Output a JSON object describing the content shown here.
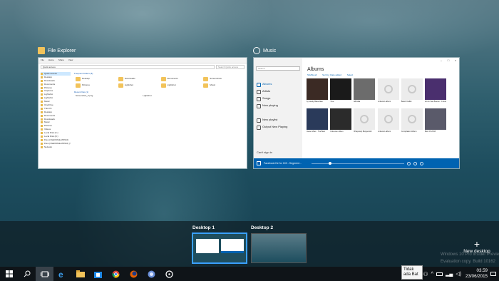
{
  "file_explorer": {
    "title": "File Explorer",
    "ribbon": [
      "File",
      "Home",
      "Share",
      "View"
    ],
    "address": "Quick access",
    "search_placeholder": "Search Quick access",
    "nav": [
      "Quick access",
      "Desktop",
      "Downloads",
      "Documents",
      "Pictures",
      "Captures",
      "Lightshot",
      "Lightshot",
      "Music",
      "OneDrive",
      "This PC",
      "Desktop",
      "Documents",
      "Downloads",
      "Music",
      "Pictures",
      "Videos",
      "Local Disk (C:)",
      "Local Disk (D:)",
      "Files (\\\\GEORGE-WIN10)",
      "Files (\\\\GEORGE-WIN10) (Y:)",
      "Network"
    ],
    "frequent_header": "Frequent folders (8)",
    "folders": [
      "Desktop",
      "Downloads",
      "Documents",
      "Screenshots",
      "Pictures",
      "Lightshot",
      "Lightshot",
      "Music"
    ],
    "recent_header": "Recent files (1)",
    "recent_file": "Screenshot_3.png",
    "recent_path": "Lightshot"
  },
  "music": {
    "title": "Music",
    "app_name": "Music",
    "search_placeholder": "Search",
    "nav": [
      "Albums",
      "Artists",
      "Songs",
      "Now playing",
      "New playlist",
      "Output New Playing"
    ],
    "sign_in": "Can't sign in",
    "heading": "Albums",
    "options": [
      "Shuffle all",
      "Sort by: Date added",
      "Select"
    ],
    "albums": [
      {
        "title": "by Vanity Babe Alan",
        "color": "#3b2a24"
      },
      {
        "title": "True",
        "color": "#1a1a1a"
      },
      {
        "title": "Ellinikia",
        "color": "#6c6c6c"
      },
      {
        "title": "Unknown album",
        "color": "#ececec"
      },
      {
        "title": "Board Catfat",
        "color": "#ececec"
      },
      {
        "title": "Armin Van Buuren - Future",
        "color": "#4a2f6e"
      },
      {
        "title": "Jason Mraz - The Best",
        "color": "#2a3a5a"
      },
      {
        "title": "Unknown album",
        "color": "#2b2b2b"
      },
      {
        "title": "Rhapsody Bergamotti",
        "color": "#ececec"
      },
      {
        "title": "Unknown album",
        "color": "#ececec"
      },
      {
        "title": "Compilation Album",
        "color": "#ececec"
      },
      {
        "title": "Best Of 2016",
        "color": "#5a5a6a"
      }
    ],
    "now_playing": "Facebook De for 103 - Segment...",
    "accent": "#0063b1"
  },
  "desktops": {
    "desktop1": "Desktop 1",
    "desktop2": "Desktop 2",
    "new_desktop": "New desktop"
  },
  "watermark": [
    "Windows 10 Pro Insider Preview",
    "Evaluation copy. Build 10162"
  ],
  "notification": "Tidak ada Bat",
  "clock": {
    "time": "03.59",
    "date": "23/06/2015"
  }
}
